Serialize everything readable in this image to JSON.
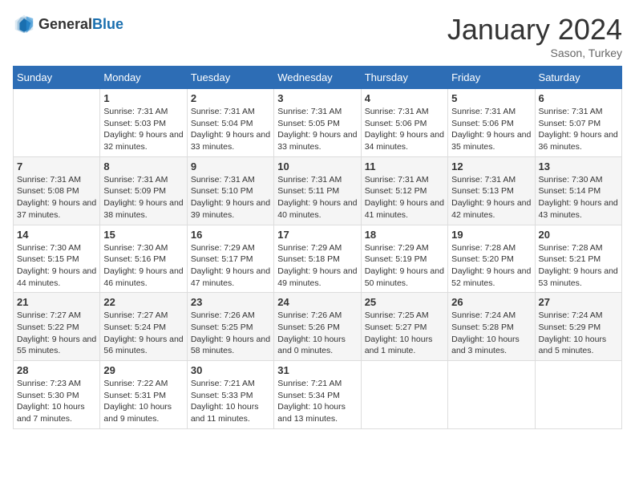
{
  "logo": {
    "text_general": "General",
    "text_blue": "Blue"
  },
  "header": {
    "month_title": "January 2024",
    "location": "Sason, Turkey"
  },
  "days_of_week": [
    "Sunday",
    "Monday",
    "Tuesday",
    "Wednesday",
    "Thursday",
    "Friday",
    "Saturday"
  ],
  "weeks": [
    [
      {
        "day": "",
        "sunrise": "",
        "sunset": "",
        "daylight": ""
      },
      {
        "day": "1",
        "sunrise": "Sunrise: 7:31 AM",
        "sunset": "Sunset: 5:03 PM",
        "daylight": "Daylight: 9 hours and 32 minutes."
      },
      {
        "day": "2",
        "sunrise": "Sunrise: 7:31 AM",
        "sunset": "Sunset: 5:04 PM",
        "daylight": "Daylight: 9 hours and 33 minutes."
      },
      {
        "day": "3",
        "sunrise": "Sunrise: 7:31 AM",
        "sunset": "Sunset: 5:05 PM",
        "daylight": "Daylight: 9 hours and 33 minutes."
      },
      {
        "day": "4",
        "sunrise": "Sunrise: 7:31 AM",
        "sunset": "Sunset: 5:06 PM",
        "daylight": "Daylight: 9 hours and 34 minutes."
      },
      {
        "day": "5",
        "sunrise": "Sunrise: 7:31 AM",
        "sunset": "Sunset: 5:06 PM",
        "daylight": "Daylight: 9 hours and 35 minutes."
      },
      {
        "day": "6",
        "sunrise": "Sunrise: 7:31 AM",
        "sunset": "Sunset: 5:07 PM",
        "daylight": "Daylight: 9 hours and 36 minutes."
      }
    ],
    [
      {
        "day": "7",
        "sunrise": "Sunrise: 7:31 AM",
        "sunset": "Sunset: 5:08 PM",
        "daylight": "Daylight: 9 hours and 37 minutes."
      },
      {
        "day": "8",
        "sunrise": "Sunrise: 7:31 AM",
        "sunset": "Sunset: 5:09 PM",
        "daylight": "Daylight: 9 hours and 38 minutes."
      },
      {
        "day": "9",
        "sunrise": "Sunrise: 7:31 AM",
        "sunset": "Sunset: 5:10 PM",
        "daylight": "Daylight: 9 hours and 39 minutes."
      },
      {
        "day": "10",
        "sunrise": "Sunrise: 7:31 AM",
        "sunset": "Sunset: 5:11 PM",
        "daylight": "Daylight: 9 hours and 40 minutes."
      },
      {
        "day": "11",
        "sunrise": "Sunrise: 7:31 AM",
        "sunset": "Sunset: 5:12 PM",
        "daylight": "Daylight: 9 hours and 41 minutes."
      },
      {
        "day": "12",
        "sunrise": "Sunrise: 7:31 AM",
        "sunset": "Sunset: 5:13 PM",
        "daylight": "Daylight: 9 hours and 42 minutes."
      },
      {
        "day": "13",
        "sunrise": "Sunrise: 7:30 AM",
        "sunset": "Sunset: 5:14 PM",
        "daylight": "Daylight: 9 hours and 43 minutes."
      }
    ],
    [
      {
        "day": "14",
        "sunrise": "Sunrise: 7:30 AM",
        "sunset": "Sunset: 5:15 PM",
        "daylight": "Daylight: 9 hours and 44 minutes."
      },
      {
        "day": "15",
        "sunrise": "Sunrise: 7:30 AM",
        "sunset": "Sunset: 5:16 PM",
        "daylight": "Daylight: 9 hours and 46 minutes."
      },
      {
        "day": "16",
        "sunrise": "Sunrise: 7:29 AM",
        "sunset": "Sunset: 5:17 PM",
        "daylight": "Daylight: 9 hours and 47 minutes."
      },
      {
        "day": "17",
        "sunrise": "Sunrise: 7:29 AM",
        "sunset": "Sunset: 5:18 PM",
        "daylight": "Daylight: 9 hours and 49 minutes."
      },
      {
        "day": "18",
        "sunrise": "Sunrise: 7:29 AM",
        "sunset": "Sunset: 5:19 PM",
        "daylight": "Daylight: 9 hours and 50 minutes."
      },
      {
        "day": "19",
        "sunrise": "Sunrise: 7:28 AM",
        "sunset": "Sunset: 5:20 PM",
        "daylight": "Daylight: 9 hours and 52 minutes."
      },
      {
        "day": "20",
        "sunrise": "Sunrise: 7:28 AM",
        "sunset": "Sunset: 5:21 PM",
        "daylight": "Daylight: 9 hours and 53 minutes."
      }
    ],
    [
      {
        "day": "21",
        "sunrise": "Sunrise: 7:27 AM",
        "sunset": "Sunset: 5:22 PM",
        "daylight": "Daylight: 9 hours and 55 minutes."
      },
      {
        "day": "22",
        "sunrise": "Sunrise: 7:27 AM",
        "sunset": "Sunset: 5:24 PM",
        "daylight": "Daylight: 9 hours and 56 minutes."
      },
      {
        "day": "23",
        "sunrise": "Sunrise: 7:26 AM",
        "sunset": "Sunset: 5:25 PM",
        "daylight": "Daylight: 9 hours and 58 minutes."
      },
      {
        "day": "24",
        "sunrise": "Sunrise: 7:26 AM",
        "sunset": "Sunset: 5:26 PM",
        "daylight": "Daylight: 10 hours and 0 minutes."
      },
      {
        "day": "25",
        "sunrise": "Sunrise: 7:25 AM",
        "sunset": "Sunset: 5:27 PM",
        "daylight": "Daylight: 10 hours and 1 minute."
      },
      {
        "day": "26",
        "sunrise": "Sunrise: 7:24 AM",
        "sunset": "Sunset: 5:28 PM",
        "daylight": "Daylight: 10 hours and 3 minutes."
      },
      {
        "day": "27",
        "sunrise": "Sunrise: 7:24 AM",
        "sunset": "Sunset: 5:29 PM",
        "daylight": "Daylight: 10 hours and 5 minutes."
      }
    ],
    [
      {
        "day": "28",
        "sunrise": "Sunrise: 7:23 AM",
        "sunset": "Sunset: 5:30 PM",
        "daylight": "Daylight: 10 hours and 7 minutes."
      },
      {
        "day": "29",
        "sunrise": "Sunrise: 7:22 AM",
        "sunset": "Sunset: 5:31 PM",
        "daylight": "Daylight: 10 hours and 9 minutes."
      },
      {
        "day": "30",
        "sunrise": "Sunrise: 7:21 AM",
        "sunset": "Sunset: 5:33 PM",
        "daylight": "Daylight: 10 hours and 11 minutes."
      },
      {
        "day": "31",
        "sunrise": "Sunrise: 7:21 AM",
        "sunset": "Sunset: 5:34 PM",
        "daylight": "Daylight: 10 hours and 13 minutes."
      },
      {
        "day": "",
        "sunrise": "",
        "sunset": "",
        "daylight": ""
      },
      {
        "day": "",
        "sunrise": "",
        "sunset": "",
        "daylight": ""
      },
      {
        "day": "",
        "sunrise": "",
        "sunset": "",
        "daylight": ""
      }
    ]
  ]
}
